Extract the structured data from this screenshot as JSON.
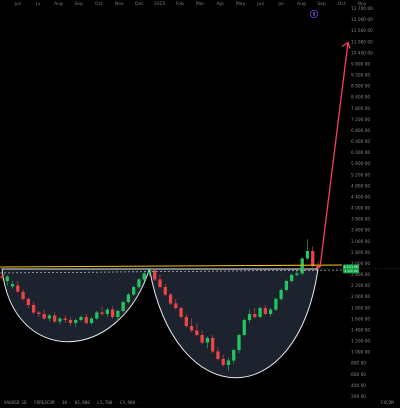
{
  "chart_data": {
    "type": "candlestick",
    "title": "",
    "xlabel": "",
    "ylabel": "",
    "x_tick_labels": [
      "Jun",
      "Ju",
      "Aug",
      "Sep",
      "Oct",
      "Nov",
      "Dec",
      "2025",
      "Feb",
      "Mar",
      "Apr",
      "May",
      "Jun",
      "Jul",
      "Aug",
      "Sep",
      "Oct",
      "Nov"
    ],
    "y_tick_labels": [
      "12 700 00",
      "12 000 00",
      "11 500 00",
      "11 000 00",
      "10 400 00",
      "9 800 00",
      "9 200 00",
      "8 800 00",
      "8 400 00",
      "7 800 00",
      "7 200 00",
      "6 800 00",
      "6 400 00",
      "6 000 00",
      "5 600 00",
      "5 200 00",
      "4 800 00",
      "4 400 00",
      "4 000 00",
      "3 800 00",
      "3 400 00",
      "3 000 00",
      "2 800 00",
      "2 600 00",
      "2 400 00",
      "2 200 00",
      "2 000 00",
      "1 800 00",
      "1 600 00",
      "1 400 00",
      "1 200 00",
      "1 000 00",
      "800 00",
      "600 00",
      "400 00",
      "200 00"
    ],
    "ylim": [
      0,
      12800000
    ],
    "price_label": "4 121 00",
    "price_label_sub": "4 121 00",
    "neckline_level": 4100000,
    "target_level": 11650000,
    "bottom_left_text": "XAUUSD 1D · FOREXCOM · 30 · H3,800 · L3,700 · C3,900 ·",
    "bottom_right_text": "FXCOM",
    "top_marker_text": "8",
    "colors": {
      "up": "#22c55e",
      "down": "#ef4444",
      "cup": "#e5e7eb",
      "cup_fill": "#1f2733",
      "neckline": "#f5c518",
      "target_arrow": "#f43f5e",
      "price_label_bg": "#16a34a",
      "marker": "#7c3aed"
    },
    "ohlc": [
      {
        "o": 3850000,
        "h": 3980000,
        "l": 3720000,
        "c": 3800000
      },
      {
        "o": 3700000,
        "h": 3900000,
        "l": 3550000,
        "c": 3850000
      },
      {
        "o": 3520000,
        "h": 3700000,
        "l": 3450000,
        "c": 3600000
      },
      {
        "o": 3550000,
        "h": 3700000,
        "l": 3300000,
        "c": 3350000
      },
      {
        "o": 3340000,
        "h": 3420000,
        "l": 3050000,
        "c": 3100000
      },
      {
        "o": 3100000,
        "h": 3150000,
        "l": 2800000,
        "c": 2900000
      },
      {
        "o": 2900000,
        "h": 3000000,
        "l": 2600000,
        "c": 2650000
      },
      {
        "o": 2650000,
        "h": 2700000,
        "l": 2500000,
        "c": 2600000
      },
      {
        "o": 2600000,
        "h": 2750000,
        "l": 2400000,
        "c": 2450000
      },
      {
        "o": 2450000,
        "h": 2600000,
        "l": 2350000,
        "c": 2550000
      },
      {
        "o": 2550000,
        "h": 2650000,
        "l": 2300000,
        "c": 2350000
      },
      {
        "o": 2350000,
        "h": 2500000,
        "l": 2250000,
        "c": 2450000
      },
      {
        "o": 2450000,
        "h": 2550000,
        "l": 2300000,
        "c": 2400000
      },
      {
        "o": 2400000,
        "h": 2500000,
        "l": 2200000,
        "c": 2300000
      },
      {
        "o": 2300000,
        "h": 2450000,
        "l": 2180000,
        "c": 2400000
      },
      {
        "o": 2400000,
        "h": 2550000,
        "l": 2350000,
        "c": 2500000
      },
      {
        "o": 2500000,
        "h": 2600000,
        "l": 2250000,
        "c": 2300000
      },
      {
        "o": 2300000,
        "h": 2500000,
        "l": 2250000,
        "c": 2450000
      },
      {
        "o": 2450000,
        "h": 2700000,
        "l": 2400000,
        "c": 2650000
      },
      {
        "o": 2650000,
        "h": 2850000,
        "l": 2550000,
        "c": 2600000
      },
      {
        "o": 2600000,
        "h": 2800000,
        "l": 2500000,
        "c": 2750000
      },
      {
        "o": 2750000,
        "h": 2850000,
        "l": 2450000,
        "c": 2500000
      },
      {
        "o": 2500000,
        "h": 2750000,
        "l": 2400000,
        "c": 2700000
      },
      {
        "o": 2700000,
        "h": 3050000,
        "l": 2650000,
        "c": 3000000
      },
      {
        "o": 3000000,
        "h": 3300000,
        "l": 2950000,
        "c": 3250000
      },
      {
        "o": 3250000,
        "h": 3550000,
        "l": 3200000,
        "c": 3500000
      },
      {
        "o": 3500000,
        "h": 3800000,
        "l": 3450000,
        "c": 3750000
      },
      {
        "o": 3750000,
        "h": 4000000,
        "l": 3700000,
        "c": 3950000
      },
      {
        "o": 3950000,
        "h": 4100000,
        "l": 3850000,
        "c": 4050000
      },
      {
        "o": 4050000,
        "h": 4120000,
        "l": 3700000,
        "c": 3750000
      },
      {
        "o": 3750000,
        "h": 3900000,
        "l": 3450000,
        "c": 3500000
      },
      {
        "o": 3500000,
        "h": 3600000,
        "l": 3200000,
        "c": 3250000
      },
      {
        "o": 3250000,
        "h": 3300000,
        "l": 2900000,
        "c": 2950000
      },
      {
        "o": 2950000,
        "h": 3100000,
        "l": 2750000,
        "c": 2800000
      },
      {
        "o": 2800000,
        "h": 2850000,
        "l": 2450000,
        "c": 2500000
      },
      {
        "o": 2500000,
        "h": 2600000,
        "l": 2150000,
        "c": 2200000
      },
      {
        "o": 2200000,
        "h": 2450000,
        "l": 2000000,
        "c": 2050000
      },
      {
        "o": 2050000,
        "h": 2300000,
        "l": 1850000,
        "c": 1900000
      },
      {
        "o": 1900000,
        "h": 2050000,
        "l": 1600000,
        "c": 1650000
      },
      {
        "o": 1650000,
        "h": 1850000,
        "l": 1450000,
        "c": 1800000
      },
      {
        "o": 1800000,
        "h": 1900000,
        "l": 1300000,
        "c": 1350000
      },
      {
        "o": 1350000,
        "h": 1500000,
        "l": 1050000,
        "c": 1100000
      },
      {
        "o": 1100000,
        "h": 1250000,
        "l": 850000,
        "c": 900000
      },
      {
        "o": 900000,
        "h": 1150000,
        "l": 700000,
        "c": 1050000
      },
      {
        "o": 1050000,
        "h": 1450000,
        "l": 950000,
        "c": 1400000
      },
      {
        "o": 1400000,
        "h": 1950000,
        "l": 1300000,
        "c": 1900000
      },
      {
        "o": 1900000,
        "h": 2450000,
        "l": 1850000,
        "c": 2400000
      },
      {
        "o": 2400000,
        "h": 2750000,
        "l": 2300000,
        "c": 2600000
      },
      {
        "o": 2600000,
        "h": 2800000,
        "l": 2450000,
        "c": 2500000
      },
      {
        "o": 2500000,
        "h": 2850000,
        "l": 2450000,
        "c": 2800000
      },
      {
        "o": 2800000,
        "h": 2900000,
        "l": 2550000,
        "c": 2600000
      },
      {
        "o": 2600000,
        "h": 2800000,
        "l": 2500000,
        "c": 2750000
      },
      {
        "o": 2750000,
        "h": 3150000,
        "l": 2700000,
        "c": 3100000
      },
      {
        "o": 3100000,
        "h": 3450000,
        "l": 3050000,
        "c": 3400000
      },
      {
        "o": 3400000,
        "h": 3750000,
        "l": 3350000,
        "c": 3700000
      },
      {
        "o": 3700000,
        "h": 3950000,
        "l": 3650000,
        "c": 3900000
      },
      {
        "o": 3900000,
        "h": 4100000,
        "l": 3850000,
        "c": 3950000
      },
      {
        "o": 3950000,
        "h": 4500000,
        "l": 3900000,
        "c": 4450000
      },
      {
        "o": 4450000,
        "h": 5100000,
        "l": 4400000,
        "c": 4700000
      },
      {
        "o": 4700000,
        "h": 4850000,
        "l": 4150000,
        "c": 4200000
      },
      {
        "o": 4200000,
        "h": 4350000,
        "l": 4050000,
        "c": 4121000
      }
    ]
  }
}
